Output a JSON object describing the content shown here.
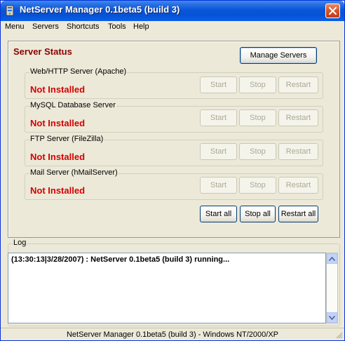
{
  "window": {
    "title": "NetServer Manager 0.1beta5 (build 3)"
  },
  "menu": [
    "Menu",
    "Servers",
    "Shortcuts",
    "Tools",
    "Help"
  ],
  "status": {
    "title": "Server Status",
    "manage_label": "Manage Servers",
    "servers": [
      {
        "name": "Web/HTTP Server (Apache)",
        "state": "Not Installed",
        "start": "Start",
        "stop": "Stop",
        "restart": "Restart"
      },
      {
        "name": "MySQL Database Server",
        "state": "Not Installed",
        "start": "Start",
        "stop": "Stop",
        "restart": "Restart"
      },
      {
        "name": "FTP Server (FileZilla)",
        "state": "Not Installed",
        "start": "Start",
        "stop": "Stop",
        "restart": "Restart"
      },
      {
        "name": "Mail Server (hMailServer)",
        "state": "Not Installed",
        "start": "Start",
        "stop": "Stop",
        "restart": "Restart"
      }
    ],
    "start_all": "Start all",
    "stop_all": "Stop all",
    "restart_all": "Restart all"
  },
  "log": {
    "label": "Log",
    "lines": [
      "(13:30:13|3/28/2007) : NetServer 0.1beta5 (build 3) running..."
    ]
  },
  "statusbar": {
    "text": "NetServer Manager 0.1beta5 (build 3) - Windows NT/2000/XP"
  },
  "colors": {
    "accent_red": "#d40000",
    "title_red": "#8b0000",
    "titlebar_blue": "#0a56d8"
  }
}
